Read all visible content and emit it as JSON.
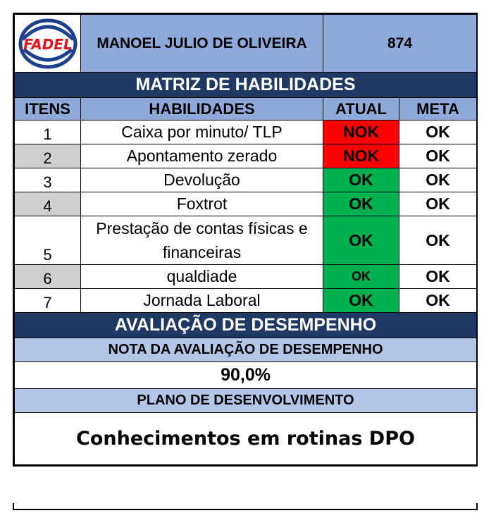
{
  "header": {
    "logo_text": "FADEL",
    "employee_name": "MANOEL JULIO DE OLIVEIRA",
    "employee_id": "874"
  },
  "matrix": {
    "title": "MATRIZ DE HABILIDADES",
    "columns": {
      "items": "ITENS",
      "skills": "HABILIDADES",
      "current": "ATUAL",
      "target": "META"
    },
    "rows": [
      {
        "item": "1",
        "skill": "Caixa por minuto/ TLP",
        "current": "NOK",
        "target": "OK"
      },
      {
        "item": "2",
        "skill": "Apontamento zerado",
        "current": "NOK",
        "target": "OK"
      },
      {
        "item": "3",
        "skill": "Devolução",
        "current": "OK",
        "target": "OK"
      },
      {
        "item": "4",
        "skill": "Foxtrot",
        "current": "OK",
        "target": "OK"
      },
      {
        "item": "5",
        "skill": "Prestação de contas físicas e financeiras",
        "current": "OK",
        "target": "OK"
      },
      {
        "item": "6",
        "skill": "qualdiade",
        "current": "OK",
        "target": "OK"
      },
      {
        "item": "7",
        "skill": "Jornada Laboral",
        "current": "OK",
        "target": "OK"
      }
    ]
  },
  "evaluation": {
    "title": "AVALIAÇÃO DE DESEMPENHO",
    "score_label": "NOTA DA AVALIAÇÃO DE DESEMPENHO",
    "score_value": "90,0%",
    "plan_label": "PLANO DE DESENVOLVIMENTO",
    "plan_value": "Conhecimentos em rotinas DPO"
  },
  "colors": {
    "header_blue": "#8eaadb",
    "banner_navy": "#1f3864",
    "light_blue": "#b4c6e7",
    "nok_red": "#ff0000",
    "ok_green": "#00b050",
    "grey": "#d0cece"
  }
}
